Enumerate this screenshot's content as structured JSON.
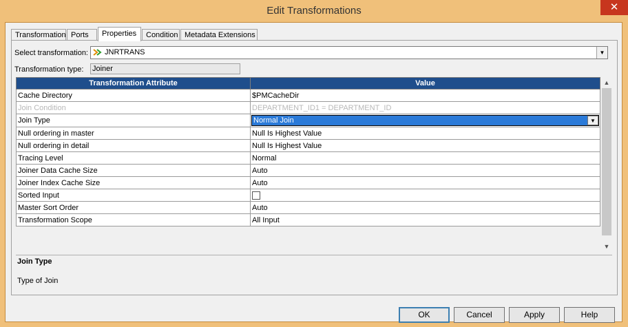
{
  "window": {
    "title": "Edit Transformations",
    "close_label": "✕"
  },
  "tabs": [
    {
      "label": "Transformation",
      "active": false
    },
    {
      "label": "Ports",
      "active": false
    },
    {
      "label": "Properties",
      "active": true
    },
    {
      "label": "Condition",
      "active": false
    },
    {
      "label": "Metadata Extensions",
      "active": false
    }
  ],
  "select_transformation": {
    "label": "Select transformation:",
    "value": "JNRTRANS",
    "icon": "joiner-icon"
  },
  "transformation_type": {
    "label": "Transformation type:",
    "value": "Joiner"
  },
  "grid": {
    "headers": [
      "Transformation Attribute",
      "Value"
    ],
    "rows": [
      {
        "attr": "Cache Directory",
        "value": "$PMCacheDir"
      },
      {
        "attr": "Join Condition",
        "value": "DEPARTMENT_ID1 = DEPARTMENT_ID"
      },
      {
        "attr": "Join Type",
        "value": "Normal Join"
      },
      {
        "attr": "Null ordering in master",
        "value": "Null Is Highest Value"
      },
      {
        "attr": "Null ordering in detail",
        "value": "Null Is Highest Value"
      },
      {
        "attr": "Tracing Level",
        "value": "Normal"
      },
      {
        "attr": "Joiner Data Cache Size",
        "value": "Auto"
      },
      {
        "attr": "Joiner Index Cache Size",
        "value": "Auto"
      },
      {
        "attr": "Sorted Input",
        "value": ""
      },
      {
        "attr": "Master Sort Order",
        "value": "Auto"
      },
      {
        "attr": "Transformation Scope",
        "value": "All Input"
      }
    ]
  },
  "description": {
    "title": "Join Type",
    "text": "Type of Join"
  },
  "buttons": {
    "ok": "OK",
    "cancel": "Cancel",
    "apply": "Apply",
    "help": "Help"
  },
  "colors": {
    "header_bg": "#1f4e8c",
    "selection": "#2b7ad8",
    "frame": "#f0c07a"
  }
}
